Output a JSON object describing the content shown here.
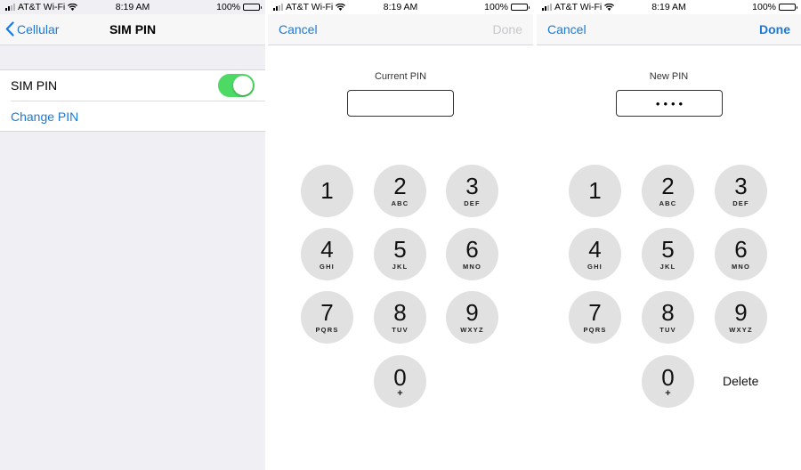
{
  "status_bar": {
    "carrier": "AT&T Wi-Fi",
    "time": "8:19 AM",
    "battery": "100%"
  },
  "settings_screen": {
    "back_label": "Cellular",
    "title": "SIM PIN",
    "sim_pin_label": "SIM PIN",
    "sim_pin_enabled": true,
    "change_pin_label": "Change PIN",
    "toggle_color": "#4cd964"
  },
  "current_pin_screen": {
    "cancel_label": "Cancel",
    "done_label": "Done",
    "done_enabled": false,
    "field_label": "Current PIN",
    "field_value": ""
  },
  "new_pin_screen": {
    "cancel_label": "Cancel",
    "done_label": "Done",
    "done_enabled": true,
    "field_label": "New PIN",
    "field_value": "••••",
    "delete_label": "Delete"
  },
  "keypad": {
    "keys": [
      {
        "digit": "1",
        "letters": ""
      },
      {
        "digit": "2",
        "letters": "ABC"
      },
      {
        "digit": "3",
        "letters": "DEF"
      },
      {
        "digit": "4",
        "letters": "GHI"
      },
      {
        "digit": "5",
        "letters": "JKL"
      },
      {
        "digit": "6",
        "letters": "MNO"
      },
      {
        "digit": "7",
        "letters": "PQRS"
      },
      {
        "digit": "8",
        "letters": "TUV"
      },
      {
        "digit": "9",
        "letters": "WXYZ"
      },
      {
        "digit": "0",
        "letters": "+"
      }
    ]
  },
  "colors": {
    "accent": "#1a7ad9",
    "disabled": "#c7c7cc",
    "key_background": "#e1e1e1"
  }
}
